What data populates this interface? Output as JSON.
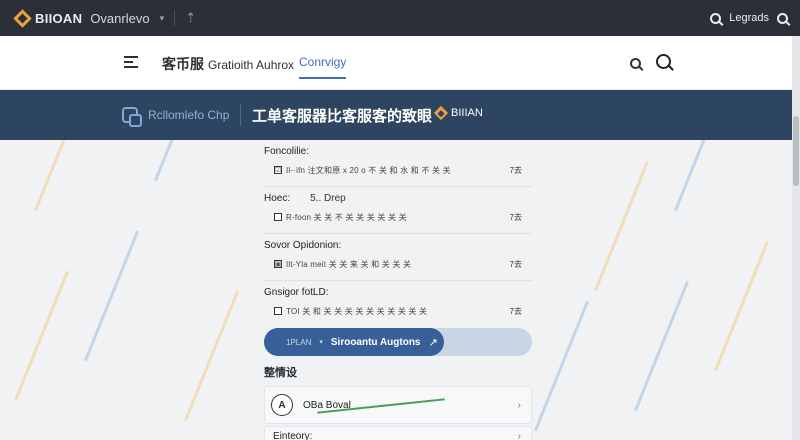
{
  "topbar": {
    "brand": "BIIOAN",
    "brand_sub": "Ovanrlevo",
    "right_label": "Legrads"
  },
  "nav": {
    "title": "客币服",
    "title_sub": "Gratioith Auhrox",
    "active_link": "Conrvigy"
  },
  "banner": {
    "left_text": "Rcllomlefo Chp",
    "title": "工单客服器比客服客的致眼",
    "brand": "BIIIAN"
  },
  "settings": [
    {
      "label": "Foncolilie:",
      "value": "",
      "option": {
        "checked": true,
        "mark": "☑",
        "text": "Il-·ifn 注文和原 x 20 o 不 关 和 水 和 不 关 关",
        "value": "7去"
      }
    },
    {
      "label": "Hoec:",
      "value": "5.. Drep",
      "option": {
        "checked": false,
        "mark": "",
        "text": "R-foon 关 关 不 关 关 关 关 关 关",
        "value": "7去"
      }
    },
    {
      "label": "Sovor Opidonion:",
      "value": "",
      "option": {
        "checked": true,
        "mark": "▣",
        "text": "Ilt-Yla meit 关 关 来 关 和 关 关 关",
        "value": "7去"
      }
    },
    {
      "label": "Gnsigor fotLD:",
      "value": "",
      "option": {
        "checked": false,
        "mark": "",
        "text": "TOI 关 和 关 关 关 关 关 关 关 关 关 关",
        "value": "7去"
      }
    }
  ],
  "action": {
    "left": "1PLAN",
    "main": "Sirooantu Augtons",
    "arrow": "↗"
  },
  "section2": {
    "heading": "整情设",
    "card_icon": "A",
    "card_label": "OBa Boval",
    "card2_label": "Einteory:"
  }
}
